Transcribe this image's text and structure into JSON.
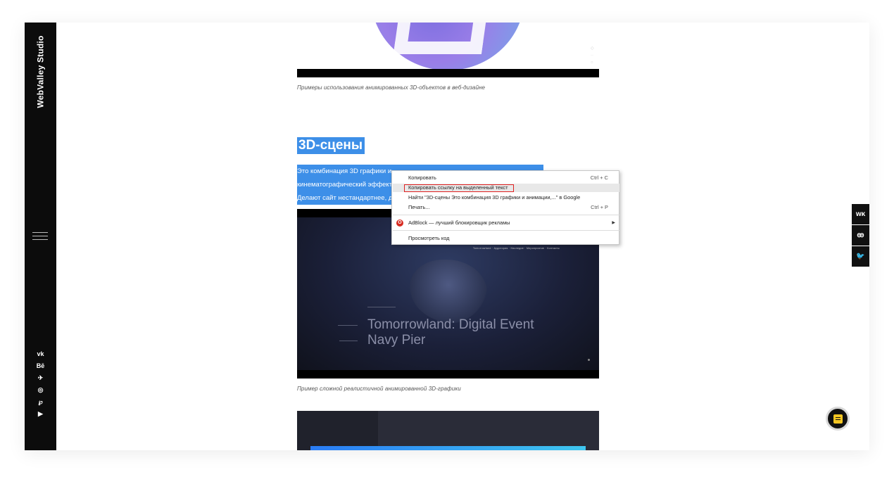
{
  "sidebar": {
    "brand": "WebValley Studio",
    "social": [
      "vk",
      "Bē",
      "✈",
      "◎",
      "℘",
      "▶"
    ],
    "social_icons": [
      "vk-icon",
      "behance-icon",
      "telegram-icon",
      "whatsapp-icon",
      "pinterest-icon",
      "youtube-icon"
    ]
  },
  "article": {
    "caption_top": "Примеры использования анимированных 3D-объектов в веб-дизайне",
    "heading": "3D-сцены",
    "para_line1": "Это комбинация 3D графики и",
    "para_line2": "кинематографический эффект",
    "para_line3": "Делают сайт нестандартнее, д",
    "video": {
      "nav": "Tomorrowland · Аудитория · Наследие · Мероприятие · Контакты",
      "title_line1": "Tomorrowland: Digital Event",
      "title_line2": "Navy Pier"
    },
    "caption_video": "Пример сложной реалистичной анимированной 3D-графики"
  },
  "context_menu": {
    "copy": "Копировать",
    "copy_shortcut": "Ctrl + C",
    "copy_link": "Копировать ссылку на выделенный текст",
    "search": "Найти \"3D-сцены Это комбинация 3D графики и анимации,...\" в Google",
    "print": "Печать...",
    "print_shortcut": "Ctrl + P",
    "adblock": "AdBlock — лучший блокировщик рекламы",
    "inspect": "Просмотреть код"
  },
  "share_bar": {
    "items": [
      "vk",
      "ok",
      "twitter"
    ],
    "labels": [
      "ᴡᴋ",
      "ꙭ",
      "🐦"
    ]
  },
  "colors": {
    "selection": "#3d8fe8",
    "sidebar": "#0c0c0c",
    "fab_note": "#f3c623",
    "highlight_outline": "#e02020"
  }
}
